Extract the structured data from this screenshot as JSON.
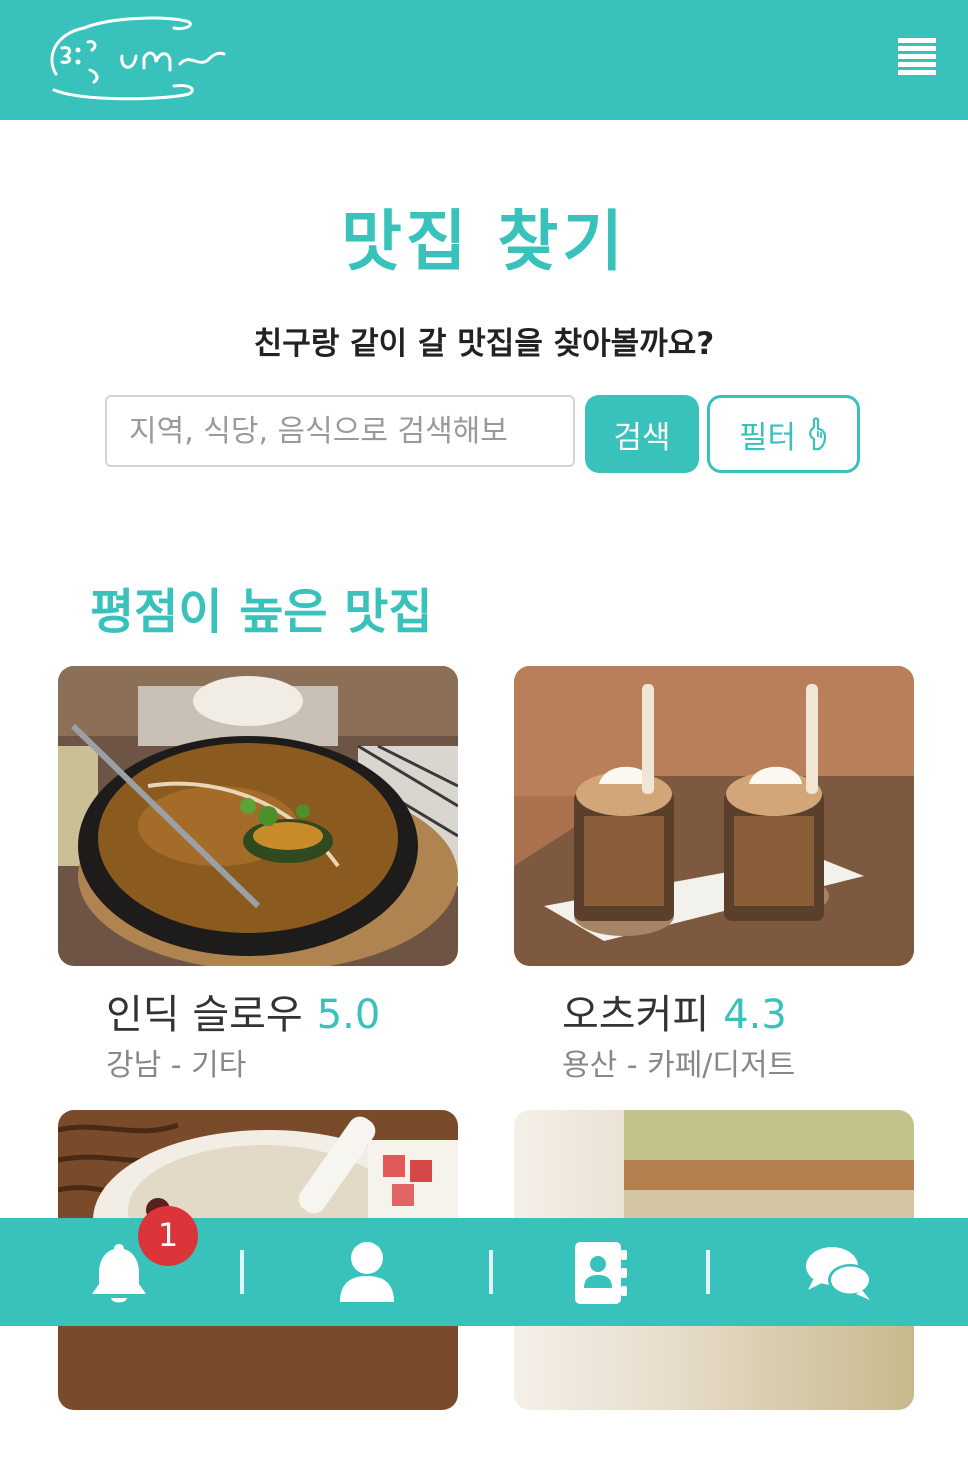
{
  "header": {
    "logo_text": "ㅌ:ㅋum~",
    "menu_icon": "hamburger-icon"
  },
  "main": {
    "title": "맛집 찾기",
    "subtitle": "친구랑 같이 갈 맛집을 찾아볼까요?",
    "search": {
      "placeholder": "지역, 식당, 음식으로 검색해보",
      "value": "",
      "button_label": "검색"
    },
    "filter": {
      "label": "필터",
      "icon": "pointing-hand-icon"
    },
    "section_title": "평점이 높은 맛집",
    "restaurants": [
      {
        "name": "인딕 슬로우",
        "rating": "5.0",
        "meta": "강남 - 기타"
      },
      {
        "name": "오츠커피",
        "rating": "4.3",
        "meta": "용산 - 카페/디저트"
      },
      {
        "name": "",
        "rating": "",
        "meta": ""
      },
      {
        "name": "",
        "rating": "",
        "meta": ""
      }
    ]
  },
  "bottom_nav": {
    "items": [
      {
        "icon": "bell-icon",
        "badge": "1"
      },
      {
        "icon": "user-icon"
      },
      {
        "icon": "address-book-icon"
      },
      {
        "icon": "chat-bubbles-icon"
      }
    ]
  },
  "colors": {
    "accent": "#38c2bb",
    "badge": "#dc3539",
    "text": "#333333",
    "muted": "#888888"
  }
}
